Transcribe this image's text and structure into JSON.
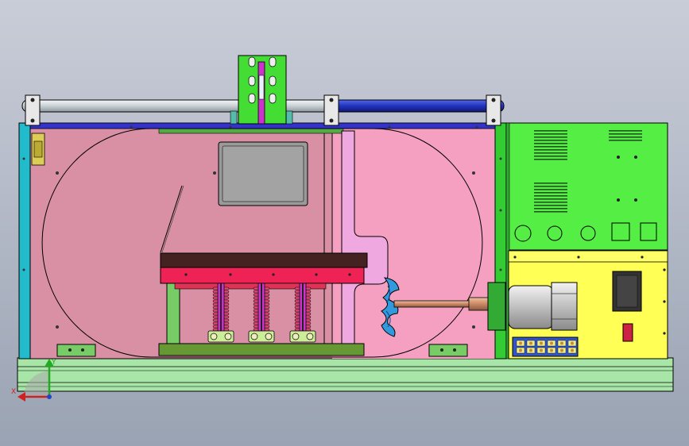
{
  "viewport": {
    "background_top": "#c9cdd8",
    "background_bottom": "#9aa3b3"
  },
  "triad": {
    "x_label": "X",
    "y_label": "Y"
  },
  "colors": {
    "outline": "#000000",
    "chamber_left": "#d990a4",
    "chamber_right": "#f5a0c0",
    "base_rail": "#a8e6a8",
    "top_bar_blue": "#3333cc",
    "rod_silver": "#d6dde0",
    "rod_blue": "#2233bb",
    "bracket_green": "#44dd33",
    "control_box": "#55ee44",
    "yellow_panel": "#ffff55",
    "cyan_frame": "#22bbcc",
    "press_dark": "#442222",
    "press_red": "#ee2255",
    "spring_pink": "#cc33cc",
    "fan_blue": "#3399dd",
    "shaft_copper": "#cc8866",
    "window_gray": "#999999",
    "olive_frame": "#669933"
  },
  "components": [
    {
      "name": "machine-frame",
      "desc": "enclosure"
    },
    {
      "name": "test-chamber",
      "desc": "chamber"
    },
    {
      "name": "control-box",
      "desc": "electrical box"
    },
    {
      "name": "motor-unit",
      "desc": "motor"
    }
  ]
}
